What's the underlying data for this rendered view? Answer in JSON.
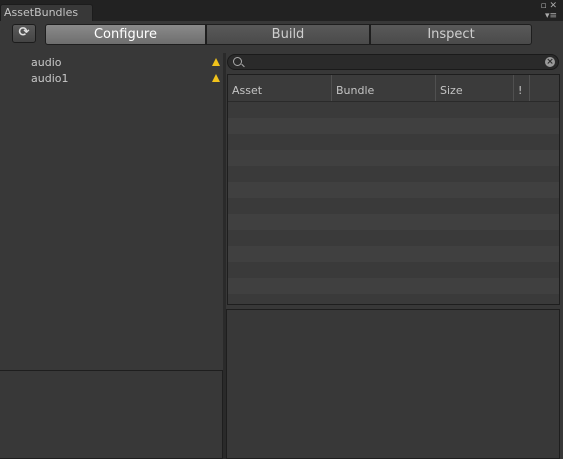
{
  "window": {
    "tab_title": "AssetBundles",
    "icons": [
      "restore-icon",
      "close-icon",
      "menu-icon"
    ]
  },
  "toolbar": {
    "refresh_icon": "refresh-icon",
    "tabs": [
      {
        "label": "Configure",
        "active": true
      },
      {
        "label": "Build",
        "active": false
      },
      {
        "label": "Inspect",
        "active": false
      }
    ]
  },
  "bundle_tree": {
    "items": [
      {
        "label": "audio",
        "warning": true
      },
      {
        "label": "audio1",
        "warning": true
      }
    ]
  },
  "search": {
    "value": "",
    "placeholder": ""
  },
  "asset_table": {
    "columns": [
      "Asset",
      "Bundle",
      "Size",
      "!"
    ],
    "rows": []
  },
  "colors": {
    "background": "#383838",
    "tab_bar": "#222222",
    "active_tab": "#7c7c7c",
    "warning": "#f0c21b"
  }
}
